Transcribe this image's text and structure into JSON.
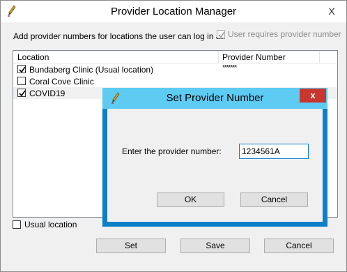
{
  "window": {
    "title": "Provider Location Manager",
    "close_glyph": "X"
  },
  "instruction": "Add provider numbers for locations the user can log in at:",
  "user_requires_provider_number": {
    "label": "User requires provider number",
    "checked": true,
    "disabled": true
  },
  "list": {
    "columns": [
      "Location",
      "Provider Number"
    ],
    "rows": [
      {
        "location": "Bundaberg Clinic (Usual location)",
        "provider_number": "*******",
        "checked": true
      },
      {
        "location": "Coral Cove Clinic",
        "provider_number": "",
        "checked": false
      },
      {
        "location": "COVID19",
        "provider_number": "",
        "checked": true
      }
    ]
  },
  "usual_location": {
    "label": "Usual location",
    "checked": false
  },
  "buttons": {
    "set": "Set",
    "save": "Save",
    "cancel": "Cancel"
  },
  "dialog": {
    "title": "Set Provider Number",
    "close_glyph": "x",
    "prompt": "Enter the provider number:",
    "value": "1234561A",
    "ok": "OK",
    "cancel": "Cancel"
  },
  "colors": {
    "dialog_titlebar": "#5ecbf3",
    "dialog_frame": "#0d7fc7",
    "dialog_close": "#c7372f",
    "selected_row": "#f0f0f0"
  }
}
